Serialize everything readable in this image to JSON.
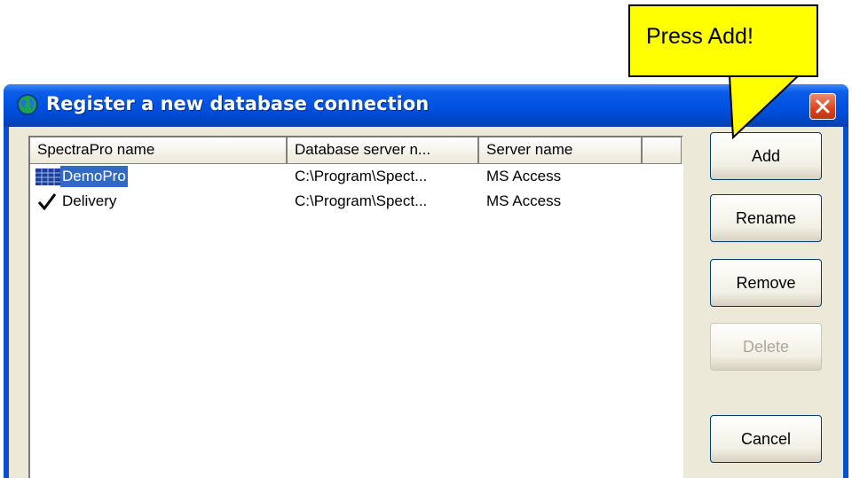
{
  "window": {
    "title": "Register a new database connection",
    "icons": {
      "title_icon": "globe-icon",
      "close": "close-icon"
    }
  },
  "list": {
    "columns": [
      "SpectraPro name",
      "Database server n...",
      "Server name",
      ""
    ],
    "rows": [
      {
        "name": "DemoPro",
        "database_server": "C:\\Program\\Spect...",
        "server_name": "MS Access",
        "icon": "database-grid-icon",
        "selected": true
      },
      {
        "name": "Delivery",
        "database_server": "C:\\Program\\Spect...",
        "server_name": "MS Access",
        "icon": "checkmark-icon",
        "selected": false
      }
    ]
  },
  "buttons": {
    "add": "Add",
    "rename": "Rename",
    "remove": "Remove",
    "delete": "Delete",
    "cancel": "Cancel"
  },
  "callout": {
    "text": "Press Add!"
  },
  "colors": {
    "titlebar": "#0050e0",
    "selection": "#316ac5",
    "callout": "#ffff00",
    "close_button": "#d9431f",
    "dialog_face": "#ece9d8"
  }
}
